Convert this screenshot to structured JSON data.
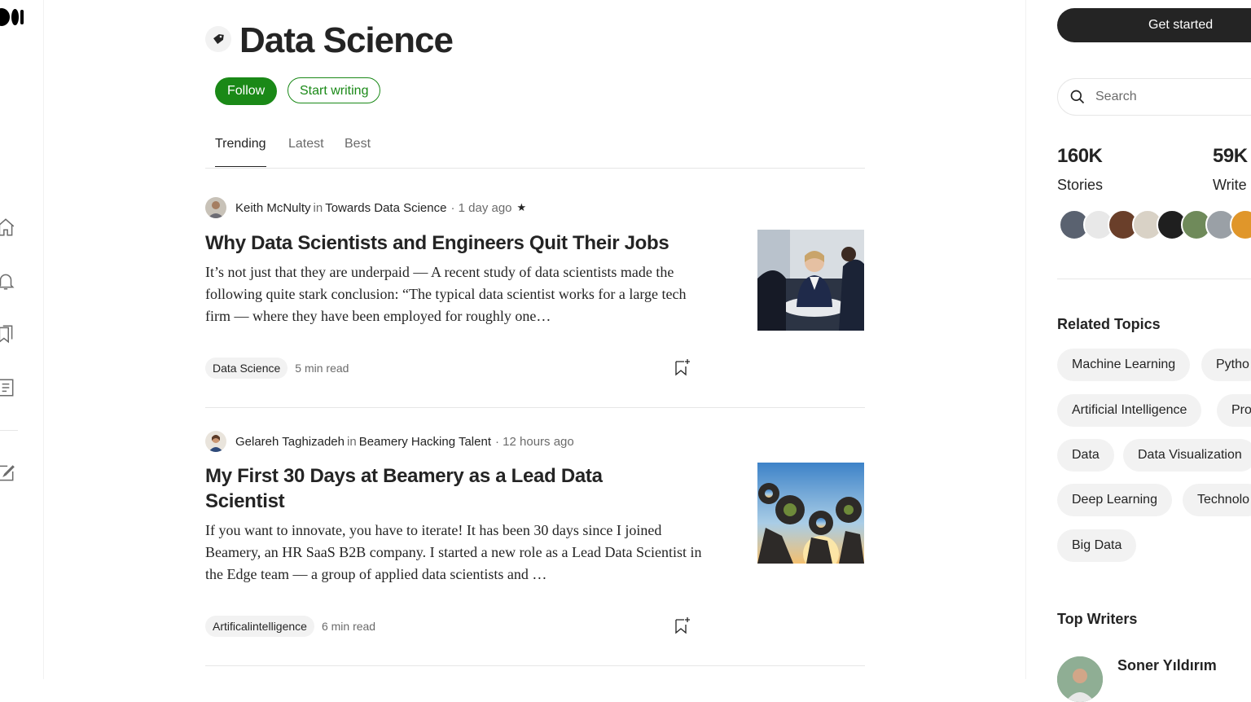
{
  "page": {
    "title": "Data Science",
    "follow_label": "Follow",
    "start_writing_label": "Start writing"
  },
  "tabs": [
    {
      "label": "Trending",
      "active": true
    },
    {
      "label": "Latest",
      "active": false
    },
    {
      "label": "Best",
      "active": false
    }
  ],
  "left_nav": {
    "icons": [
      "medium-logo",
      "home-icon",
      "bell-icon",
      "bookmarks-icon",
      "stories-icon",
      "write-icon"
    ]
  },
  "articles": [
    {
      "author": "Keith McNulty",
      "in_label": "in",
      "publication": "Towards Data Science",
      "time": "· 1 day ago",
      "star": "★",
      "title": "Why Data Scientists and Engineers Quit Their Jobs",
      "excerpt": "It’s not just that they are underpaid — A recent study of data scientists made the following quite stark conclusion: “The typical data scientist works for a large tech firm — where they have been employed for roughly one…",
      "tag": "Data Science",
      "read_time": "5 min read"
    },
    {
      "author": "Gelareh Taghizadeh",
      "in_label": "in",
      "publication": "Beamery Hacking Talent",
      "time": "· 12 hours ago",
      "title": "My First 30 Days at Beamery as a Lead Data Scientist",
      "excerpt": "If you want to innovate, you have to iterate! It has been 30 days since I joined Beamery, an HR SaaS B2B company. I started a new role as a Lead Data Scientist in the Edge team — a group of applied data scientists and …",
      "tag": "Artificalintelligence",
      "read_time": "6 min read"
    }
  ],
  "sidebar": {
    "get_started_label": "Get started",
    "search_placeholder": "Search",
    "stats": [
      {
        "value": "160K",
        "label": "Stories"
      },
      {
        "value": "59K",
        "label": "Write"
      }
    ],
    "related_topics_heading": "Related Topics",
    "topics": [
      "Machine Learning",
      "Pytho",
      "Artificial Intelligence",
      "Pro",
      "Data",
      "Data Visualization",
      "Deep Learning",
      "Technolo",
      "Big Data"
    ],
    "top_writers_heading": "Top Writers",
    "top_writer_name": "Soner Yıldırım"
  },
  "colors": {
    "accent_green": "#1a8917",
    "text": "#242424",
    "muted": "#6b6b6b"
  }
}
